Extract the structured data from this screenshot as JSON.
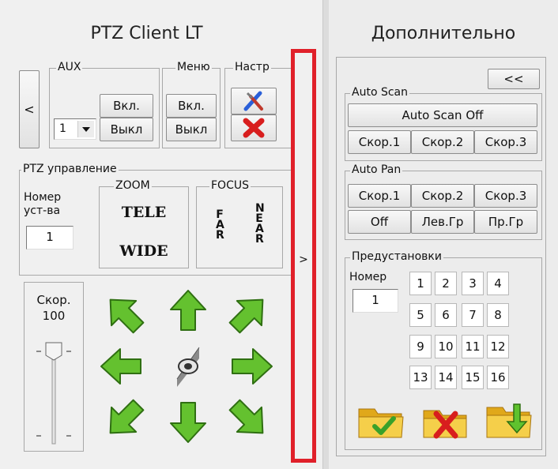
{
  "left_panel": {
    "title": "PTZ Client LT",
    "collapse_left_label": "<",
    "aux": {
      "legend": "AUX",
      "on_label": "Вкл.",
      "off_label": "Выкл",
      "select_value": "1"
    },
    "menu": {
      "legend": "Меню",
      "on_label": "Вкл.",
      "off_label": "Выкл"
    },
    "settings": {
      "legend": "Настр"
    },
    "ptz": {
      "legend": "PTZ управление",
      "device_label": "Номер\nуст-ва",
      "device_value": "1",
      "zoom": {
        "legend": "ZOOM",
        "tele": "TELE",
        "wide": "WIDE"
      },
      "focus": {
        "legend": "FOCUS",
        "far": "FAR",
        "near": "NEAR"
      },
      "speed_label": "Скор.",
      "speed_value": "100",
      "slider_level": 0.0
    }
  },
  "expand_right_label": ">",
  "highlight_color": "#e0202a",
  "right_panel": {
    "title": "Дополнительно",
    "collapse_button": "<<",
    "auto_scan": {
      "legend": "Auto Scan",
      "toggle": "Auto Scan Off",
      "speeds": [
        "Скор.1",
        "Скор.2",
        "Скор.3"
      ]
    },
    "auto_pan": {
      "legend": "Auto Pan",
      "speeds": [
        "Скор.1",
        "Скор.2",
        "Скор.3"
      ],
      "off": "Off",
      "left": "Лев.Гр",
      "right": "Пр.Гр"
    },
    "presets": {
      "legend": "Предустановки",
      "number_label": "Номер",
      "number_value": "1",
      "numbers": [
        "1",
        "2",
        "3",
        "4",
        "5",
        "6",
        "7",
        "8",
        "9",
        "10",
        "11",
        "12",
        "13",
        "14",
        "15",
        "16"
      ]
    }
  },
  "icons": {
    "arrow_color": "#5fc22e",
    "folder_color": "#f2c12e"
  }
}
